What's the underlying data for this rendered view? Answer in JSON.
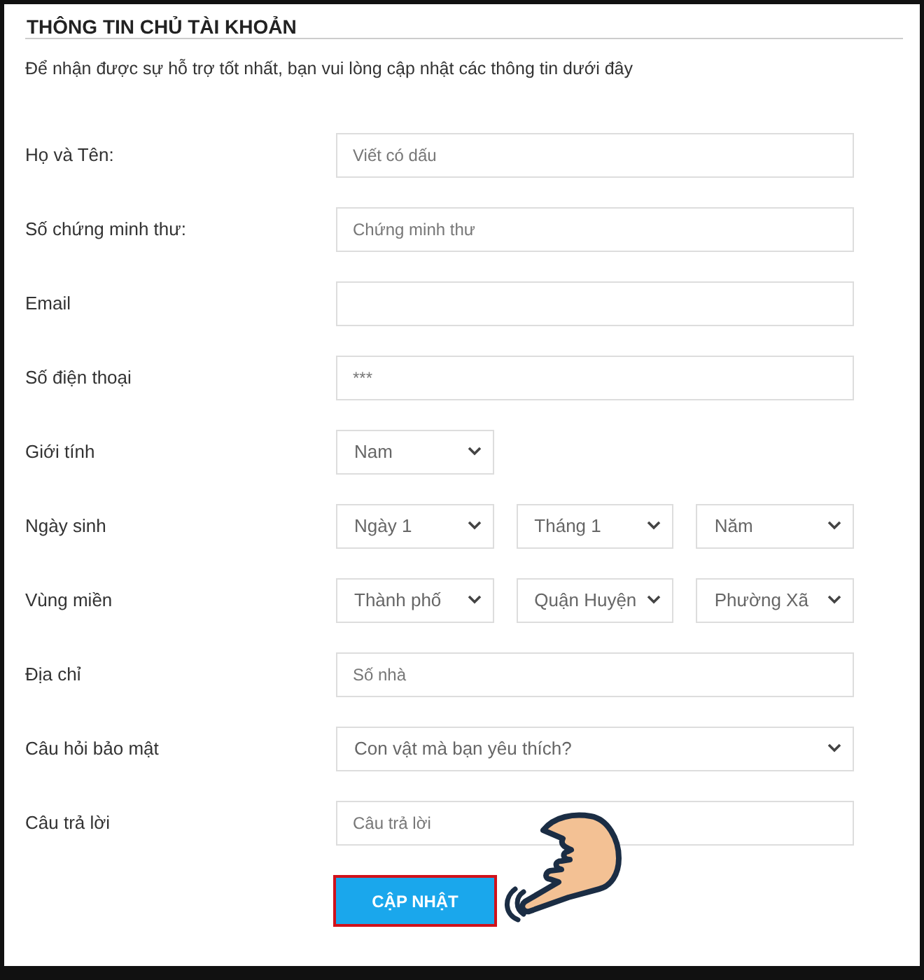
{
  "title": "THÔNG TIN CHỦ TÀI KHOẢN",
  "intro": "Để nhận được sự hỗ trợ tốt nhất, bạn vui lòng cập nhật các thông tin dưới đây",
  "rows": [
    {
      "label": "Họ và Tên:",
      "kind": "text",
      "placeholder": "Viết có dấu"
    },
    {
      "label": "Số chứng minh thư:",
      "kind": "text",
      "placeholder": "Chứng minh thư"
    },
    {
      "label": "Email",
      "kind": "text"
    },
    {
      "label": "Số điện thoại",
      "kind": "text",
      "placeholder": "***"
    },
    {
      "label": "Giới tính",
      "kind": "select",
      "selects": [
        "Nam"
      ]
    },
    {
      "label": "Ngày sinh",
      "kind": "select",
      "selects": [
        "Ngày 1",
        "Tháng 1",
        "Năm"
      ]
    },
    {
      "label": "Vùng miền",
      "kind": "select",
      "selects": [
        "Thành phố",
        "Quận Huyện",
        "Phường Xã"
      ]
    },
    {
      "label": "Địa chỉ",
      "kind": "text",
      "placeholder": "Số nhà"
    },
    {
      "label": "Câu hỏi bảo mật",
      "kind": "wide-select",
      "selects": [
        "Con vật mà bạn yêu thích?"
      ]
    },
    {
      "label": "Câu trả lời",
      "kind": "text",
      "placeholder": "Câu trả lời"
    }
  ],
  "submit": {
    "label": "CẬP NHẬT",
    "highlighted": true
  }
}
